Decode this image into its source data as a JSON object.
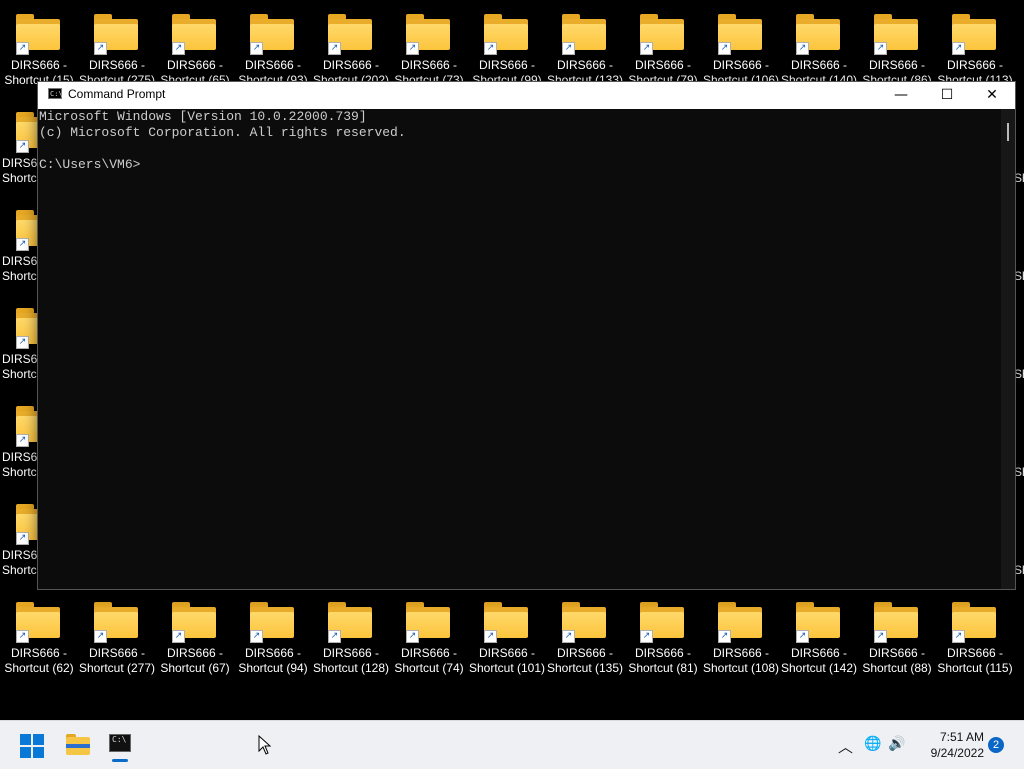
{
  "desktop": {
    "top_row_labels": [
      "DIRS666 - Shortcut (15)",
      "DIRS666 - Shortcut (275)",
      "DIRS666 - Shortcut (65)",
      "DIRS666 - Shortcut (93)",
      "DIRS666 - Shortcut (202)",
      "DIRS666 - Shortcut (73)",
      "DIRS666 - Shortcut (99)",
      "DIRS666 - Shortcut (133)",
      "DIRS666 - Shortcut (79)",
      "DIRS666 - Shortcut (106)",
      "DIRS666 - Shortcut (140)",
      "DIRS666 - Shortcut (86)",
      "DIRS666 - Shortcut (113)"
    ],
    "left_column_labels": [
      "DIRS666 - Shortcut",
      "DIRS666 - Shortcut",
      "DIRS666 - Shortcut",
      "DIRS666 - Shortcut",
      "DIRS666 - Shortcut"
    ],
    "bottom_row_labels": [
      "DIRS666 - Shortcut (62)",
      "DIRS666 - Shortcut (277)",
      "DIRS666 - Shortcut (67)",
      "DIRS666 - Shortcut (94)",
      "DIRS666 - Shortcut (128)",
      "DIRS666 - Shortcut (74)",
      "DIRS666 - Shortcut (101)",
      "DIRS666 - Shortcut (135)",
      "DIRS666 - Shortcut (81)",
      "DIRS666 - Shortcut (108)",
      "DIRS666 - Shortcut (142)",
      "DIRS666 - Shortcut (88)",
      "DIRS666 - Shortcut (115)"
    ],
    "right_edge_label": "Sh"
  },
  "window": {
    "title": "Command Prompt",
    "minimize": "—",
    "maximize": "☐",
    "close": "✕",
    "icon_text": "C:\\",
    "console_lines": [
      "Microsoft Windows [Version 10.0.22000.739]",
      "(c) Microsoft Corporation. All rights reserved.",
      "",
      "C:\\Users\\VM6>"
    ]
  },
  "taskbar": {
    "time": "7:51 AM",
    "date": "9/24/2022",
    "notification_count": "2",
    "chevron": "︿",
    "globe": "🌐",
    "volume": "🔊",
    "cmd_icon_text": "C:\\"
  },
  "colors": {
    "console_bg": "#0c0c0c",
    "console_text": "#cccccc",
    "accent": "#0a78d7"
  }
}
